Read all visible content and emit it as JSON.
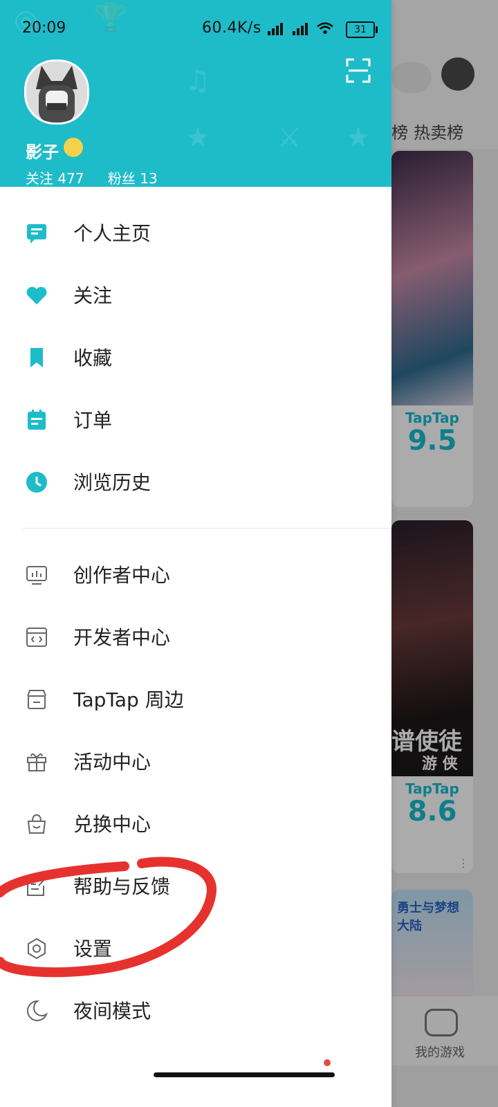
{
  "status": {
    "time": "20:09",
    "speed": "60.4K/s",
    "battery": "31"
  },
  "profile": {
    "name": "影子",
    "following_label": "关注 477",
    "fans_label": "粉丝 13"
  },
  "menu_primary": [
    {
      "label": "个人主页",
      "icon": "profile-icon"
    },
    {
      "label": "关注",
      "icon": "heart-icon"
    },
    {
      "label": "收藏",
      "icon": "bookmark-icon"
    },
    {
      "label": "订单",
      "icon": "order-icon"
    },
    {
      "label": "浏览历史",
      "icon": "clock-icon"
    }
  ],
  "menu_secondary": [
    {
      "label": "创作者中心",
      "icon": "creator-icon"
    },
    {
      "label": "开发者中心",
      "icon": "developer-icon"
    },
    {
      "label": "TapTap 周边",
      "icon": "store-icon"
    },
    {
      "label": "活动中心",
      "icon": "gift-icon"
    },
    {
      "label": "兑换中心",
      "icon": "bag-icon"
    },
    {
      "label": "帮助与反馈",
      "icon": "feedback-icon"
    },
    {
      "label": "设置",
      "icon": "settings-icon"
    },
    {
      "label": "夜间模式",
      "icon": "moon-icon"
    }
  ],
  "background": {
    "tabs": [
      "榜",
      "热卖榜"
    ],
    "cards": [
      {
        "brand": "TapTap",
        "score": "9.5"
      },
      {
        "brand": "TapTap",
        "score": "8.6"
      }
    ],
    "card2_title": "谱使徒",
    "card2_sub": "游 侠",
    "card3_title": "勇士与梦想大陆",
    "bottom_tab_label": "我的游戏"
  },
  "colors": {
    "accent": "#1ebcc9",
    "annotation": "#e6322e"
  }
}
